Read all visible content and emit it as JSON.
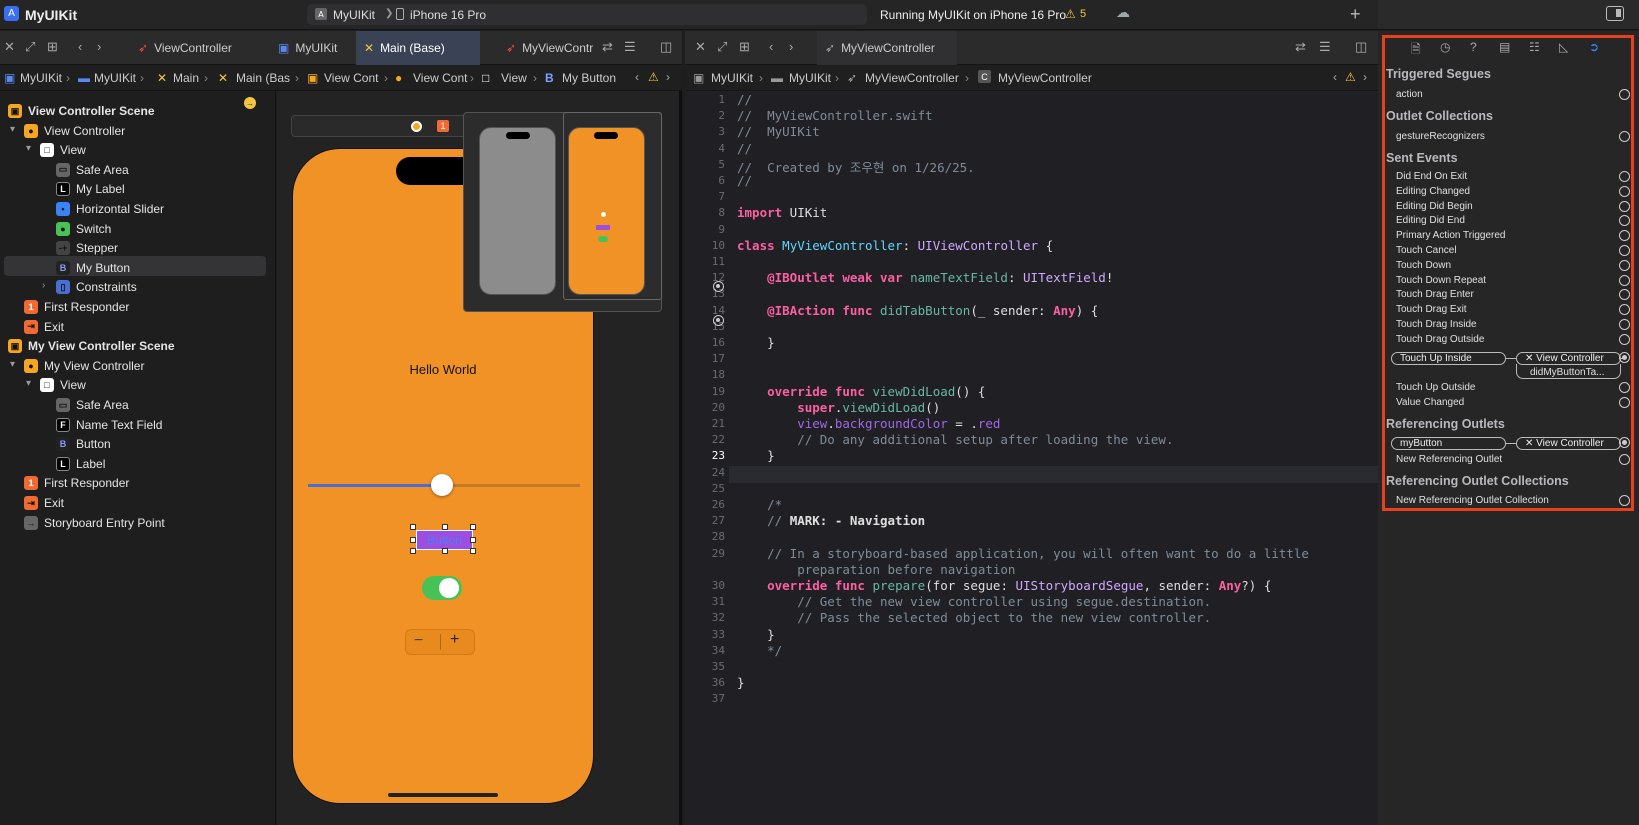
{
  "titlebar": {
    "app_name": "MyUIKit",
    "scheme_target": "MyUIKit",
    "scheme_device": "iPhone 16 Pro",
    "status": "Running MyUIKit on iPhone 16 Pro",
    "warning_count": "5"
  },
  "left_tabs": [
    "ViewController",
    "MyUIKit",
    "Main (Base)",
    "MyViewContr"
  ],
  "left_path": [
    "MyUIKit",
    "MyUIKit",
    "Main",
    "Main (Bas",
    "View Cont",
    "View Cont",
    "View",
    "My Button"
  ],
  "right_tabs": [
    "MyViewController"
  ],
  "right_path": [
    "MyUIKit",
    "MyUIKit",
    "MyViewController",
    "MyViewController"
  ],
  "navigator": [
    {
      "label": "View Controller Scene",
      "bold": true,
      "icon": "scene-icon"
    },
    {
      "label": "View Controller",
      "icon": "view-controller-icon"
    },
    {
      "label": "View",
      "icon": "view-icon"
    },
    {
      "label": "Safe Area",
      "icon": "safe-area-icon"
    },
    {
      "label": "My Label",
      "icon": "label-icon",
      "badge": "L"
    },
    {
      "label": "Horizontal Slider",
      "icon": "slider-icon"
    },
    {
      "label": "Switch",
      "icon": "switch-icon"
    },
    {
      "label": "Stepper",
      "icon": "stepper-icon"
    },
    {
      "label": "My Button",
      "icon": "button-icon",
      "badge": "B"
    },
    {
      "label": "Constraints",
      "icon": "constraints-icon"
    },
    {
      "label": "First Responder",
      "icon": "first-responder-icon",
      "badge": "1"
    },
    {
      "label": "Exit",
      "icon": "exit-icon"
    },
    {
      "label": "My View Controller Scene",
      "bold": true,
      "icon": "scene-icon"
    },
    {
      "label": "My View Controller",
      "icon": "view-controller-icon"
    },
    {
      "label": "View",
      "icon": "view-icon"
    },
    {
      "label": "Safe Area",
      "icon": "safe-area-icon"
    },
    {
      "label": "Name Text Field",
      "icon": "text-field-icon",
      "badge": "F"
    },
    {
      "label": "Button",
      "icon": "button-icon",
      "badge": "B"
    },
    {
      "label": "Label",
      "icon": "label-icon",
      "badge": "L"
    },
    {
      "label": "First Responder",
      "icon": "first-responder-icon",
      "badge": "1"
    },
    {
      "label": "Exit",
      "icon": "exit-icon"
    },
    {
      "label": "Storyboard Entry Point",
      "icon": "entry-point-icon"
    }
  ],
  "canvas": {
    "hello_label": "Hello World",
    "button_label": "Button",
    "slider_value": 0.5,
    "switch_on": true,
    "stepper_minus": "−",
    "stepper_plus": "+",
    "scene_badge": "1"
  },
  "code_lines": [
    "//",
    "//  MyViewController.swift",
    "//  MyUIKit",
    "//",
    "//  Created by 조우현 on 1/26/25.",
    "//",
    "",
    "import UIKit",
    "",
    "class MyViewController: UIViewController {",
    "",
    "    @IBOutlet weak var nameTextField: UITextField!",
    "",
    "    @IBAction func didTabButton(_ sender: Any) {",
    "",
    "    }",
    "",
    "",
    "    override func viewDidLoad() {",
    "        super.viewDidLoad()",
    "        view.backgroundColor = .red",
    "        // Do any additional setup after loading the view.",
    "    }",
    "",
    "",
    "    /*",
    "    // MARK: - Navigation",
    "",
    "    // In a storyboard-based application, you will often want to do a little",
    "        preparation before navigation",
    "    override func prepare(for segue: UIStoryboardSegue, sender: Any?) {",
    "        // Get the new view controller using segue.destination.",
    "        // Pass the selected object to the new view controller.",
    "    }",
    "    */",
    "",
    "}",
    ""
  ],
  "line_numbers": [
    "1",
    "2",
    "3",
    "4",
    "5",
    "6",
    "7",
    "8",
    "9",
    "10",
    "11",
    "12",
    "13",
    "14",
    "15",
    "16",
    "17",
    "18",
    "19",
    "20",
    "21",
    "22",
    "23",
    "24",
    "25",
    "26",
    "27",
    "28",
    "29",
    "",
    "30",
    "31",
    "32",
    "33",
    "34",
    "35",
    "36",
    "37"
  ],
  "current_line": "23",
  "inspector": {
    "triggered_segues": "Triggered Segues",
    "segue_action": "action",
    "outlet_collections": "Outlet Collections",
    "gesture_recognizers": "gestureRecognizers",
    "sent_events": "Sent Events",
    "events": [
      "Did End On Exit",
      "Editing Changed",
      "Editing Did Begin",
      "Editing Did End",
      "Primary Action Triggered",
      "Touch Cancel",
      "Touch Down",
      "Touch Down Repeat",
      "Touch Drag Enter",
      "Touch Drag Exit",
      "Touch Drag Inside",
      "Touch Drag Outside"
    ],
    "touch_up_inside": "Touch Up Inside",
    "tui_target": "View Controller",
    "tui_action": "didMyButtonTa...",
    "events_after": [
      "Touch Up Outside",
      "Value Changed"
    ],
    "referencing_outlets": "Referencing Outlets",
    "outlet_name": "myButton",
    "outlet_target": "View Controller",
    "new_referencing_outlet": "New Referencing Outlet",
    "referencing_outlet_collections": "Referencing Outlet Collections",
    "new_referencing_outlet_collection": "New Referencing Outlet Collection",
    "accent_color": "#e8401c"
  }
}
